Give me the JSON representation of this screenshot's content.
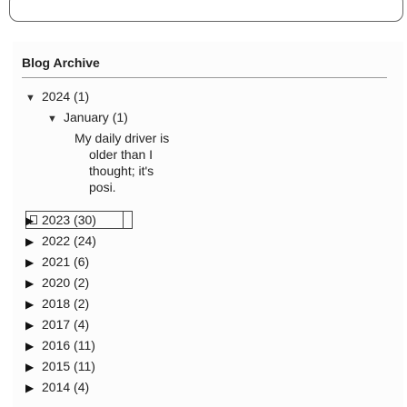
{
  "widget": {
    "title": "Blog Archive"
  },
  "archive": {
    "expanded_year": {
      "label": "2024 (1)",
      "toggle": "▼",
      "expanded_month": {
        "label": "January (1)",
        "toggle": "▼",
        "post_lines": [
          "My daily driver is",
          "older than I",
          "thought; it's",
          "posi."
        ]
      }
    },
    "collapsed_years": [
      {
        "label": "2023 (30)",
        "toggle": "▶"
      },
      {
        "label": "2022 (24)",
        "toggle": "▶"
      },
      {
        "label": "2021 (6)",
        "toggle": "▶"
      },
      {
        "label": "2020 (2)",
        "toggle": "▶"
      },
      {
        "label": "2018 (2)",
        "toggle": "▶"
      },
      {
        "label": "2017 (4)",
        "toggle": "▶"
      },
      {
        "label": "2016 (11)",
        "toggle": "▶"
      },
      {
        "label": "2015 (11)",
        "toggle": "▶"
      },
      {
        "label": "2014 (4)",
        "toggle": "▶"
      }
    ]
  }
}
